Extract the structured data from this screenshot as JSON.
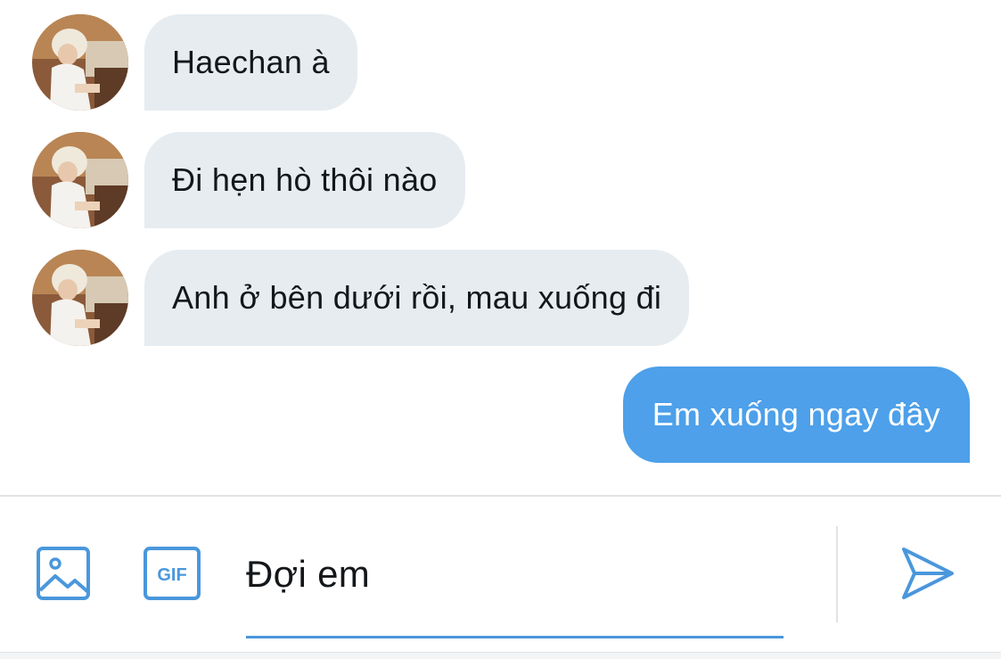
{
  "messages": [
    {
      "direction": "incoming",
      "text": "Haechan à"
    },
    {
      "direction": "incoming",
      "text": "Đi hẹn hò thôi nào"
    },
    {
      "direction": "incoming",
      "text": "Anh ở bên dưới rồi, mau xuống đi"
    },
    {
      "direction": "outgoing",
      "text": "Em xuống ngay đây"
    }
  ],
  "composer": {
    "input_value": "Đợi em",
    "gif_label": "GIF",
    "image_icon": "image-icon",
    "gif_icon": "gif-icon",
    "send_icon": "send-icon"
  },
  "colors": {
    "incoming_bubble": "#e6ecf0",
    "outgoing_bubble": "#4da0e9",
    "accent": "#4a97dc",
    "text": "#14171a"
  }
}
